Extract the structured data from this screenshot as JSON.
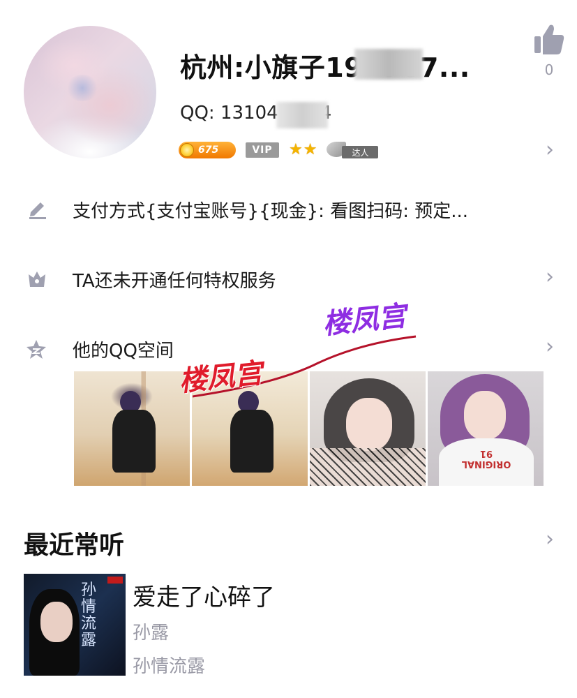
{
  "profile": {
    "name": "杭州:小旗子19",
    "name_suffix": "767...",
    "qq_label": "QQ: ",
    "qq_prefix": "13104",
    "qq_suffix": "4",
    "likes": "0",
    "coin_value": "675",
    "vip_label": "VIP",
    "daren_label": "达人"
  },
  "rows": {
    "payment": "支付方式{支付宝账号}{现金}: 看图扫码: 预定...",
    "privilege": "TA还未开通任何特权服务",
    "qzone": "他的QQ空间"
  },
  "watermark": {
    "text1": "楼凤宫",
    "text2": "楼凤宫"
  },
  "qzone_photos": {
    "shirt_text": "ORIGINAL 91"
  },
  "music": {
    "section_title": "最近常听",
    "song": "爱走了心碎了",
    "artist": "孙露",
    "album": "孙情流露",
    "album_cover_text": "孙情流露"
  },
  "colors": {
    "accent_purple": "#8e2de2",
    "watermark_red": "#e01b2b",
    "muted_gray": "#9a9aa6"
  },
  "icons": {
    "like": "thumbs-up-icon",
    "edit": "pencil-icon",
    "privilege": "crown-icon",
    "qzone": "star-icon",
    "chevron": "chevron-right-icon"
  }
}
